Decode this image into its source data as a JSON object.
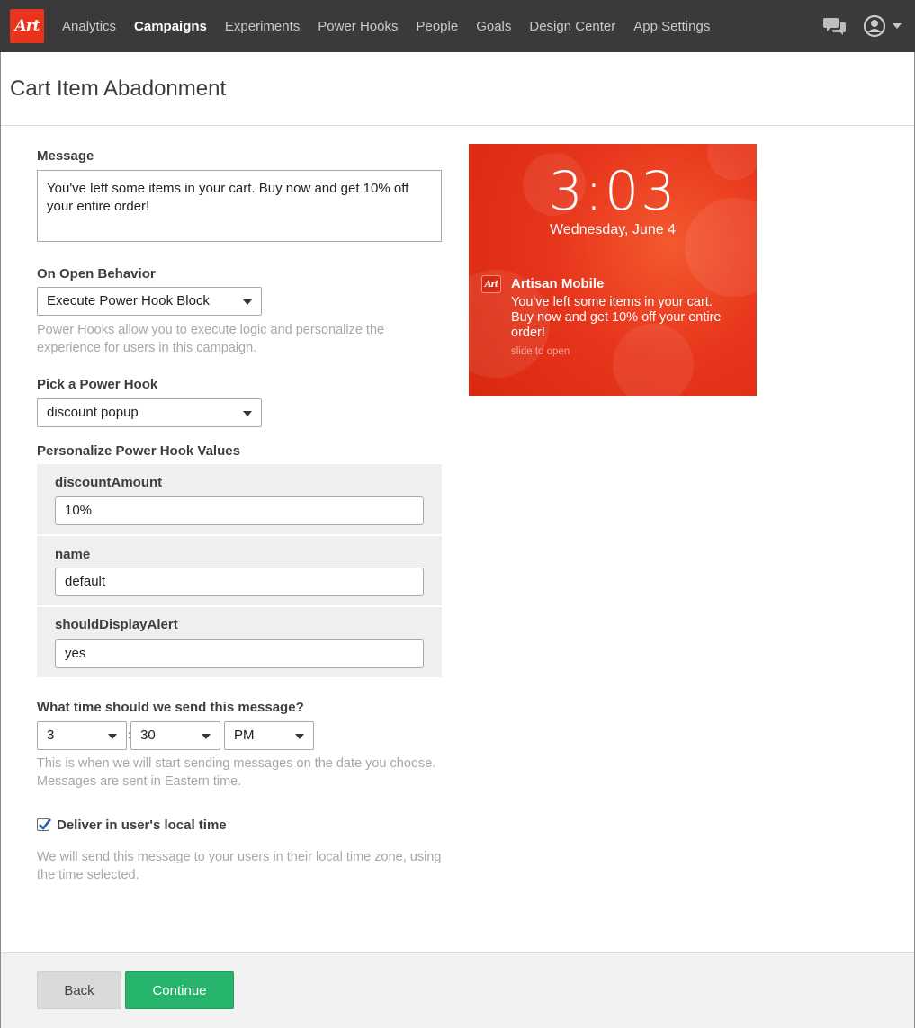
{
  "nav": {
    "logo_text": "Art",
    "items": [
      {
        "label": "Analytics",
        "active": false
      },
      {
        "label": "Campaigns",
        "active": true
      },
      {
        "label": "Experiments",
        "active": false
      },
      {
        "label": "Power Hooks",
        "active": false
      },
      {
        "label": "People",
        "active": false
      },
      {
        "label": "Goals",
        "active": false
      },
      {
        "label": "Design Center",
        "active": false
      },
      {
        "label": "App Settings",
        "active": false
      }
    ],
    "icons": [
      "chat-icon",
      "user-icon",
      "caret-down-icon"
    ]
  },
  "page": {
    "title": "Cart Item Abadonment"
  },
  "form": {
    "message_label": "Message",
    "message_value": "You've left some items in your cart. Buy now and get 10% off your entire order!",
    "on_open_label": "On Open Behavior",
    "on_open_value": "Execute Power Hook Block",
    "on_open_help": "Power Hooks allow you to execute logic and personalize the experience for users in this campaign.",
    "pick_hook_label": "Pick a Power Hook",
    "pick_hook_value": "discount popup",
    "personalize_label": "Personalize Power Hook Values",
    "hooks": [
      {
        "name": "discountAmount",
        "value": "10%"
      },
      {
        "name": "name",
        "value": "default"
      },
      {
        "name": "shouldDisplayAlert",
        "value": "yes"
      }
    ],
    "time_label": "What time should we send this message?",
    "time_hour": "3",
    "time_separator": ":",
    "time_minute": "30",
    "time_ampm": "PM",
    "time_help": "This is when we will start sending messages on the date you choose. Messages are sent in Eastern time.",
    "local_time_label": "Deliver in user's local time",
    "local_time_checked": true,
    "local_time_help": "We will send this message to your users in their local time zone, using the time selected."
  },
  "preview": {
    "time": "3:03",
    "date": "Wednesday, June 4",
    "app_icon_text": "Art",
    "app_name": "Artisan Mobile",
    "body": "You've left some items in your cart. Buy now and get 10% off your entire order!",
    "slide": "slide to open",
    "background_color": "#e8361c"
  },
  "footer": {
    "back_label": "Back",
    "continue_label": "Continue"
  },
  "colors": {
    "nav_bg": "#3a3a3a",
    "brand": "#e8341c",
    "continue": "#27b46d"
  }
}
